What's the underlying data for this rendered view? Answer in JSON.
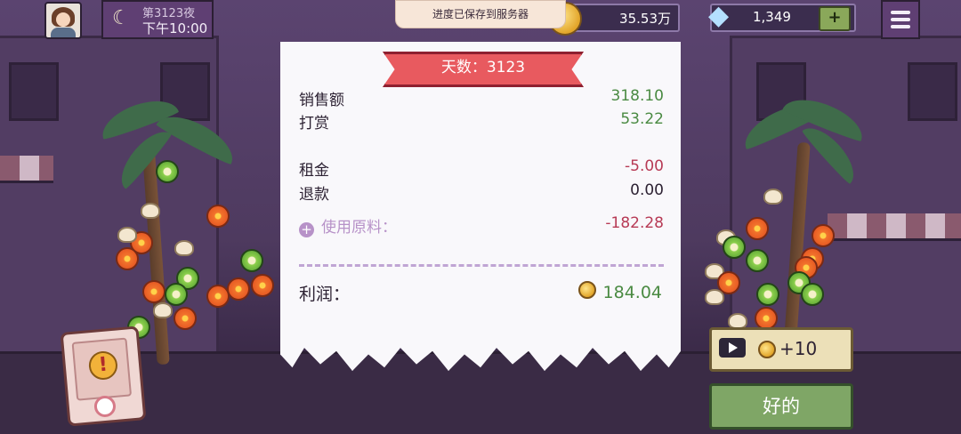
{
  "hud": {
    "avatar_icon": "player-avatar",
    "moon_icon": "moon-icon",
    "night_label": "第3123夜",
    "time_label": "下午10:00",
    "save_toast": "进度已保存到服务器",
    "money": "35.53万",
    "gems": "1,349",
    "add_label": "+",
    "menu_icon": "hamburger-menu-icon"
  },
  "receipt": {
    "day_banner": "天数：3123",
    "sales_label": "销售额",
    "sales_value": "318.10",
    "tips_label": "打赏",
    "tips_value": "53.22",
    "rent_label": "租金",
    "rent_value": "-5.00",
    "refund_label": "退款",
    "refund_value": "0.00",
    "materials_label": "使用原料：",
    "materials_value": "-182.28",
    "profit_label": "利润：",
    "profit_value": "184.04"
  },
  "actions": {
    "ad_reward": "+10",
    "ok_label": "好的"
  },
  "colors": {
    "positive": "#4a8a42",
    "negative": "#b73a55",
    "banner": "#e85a5f",
    "ok_button": "#7fa666"
  }
}
